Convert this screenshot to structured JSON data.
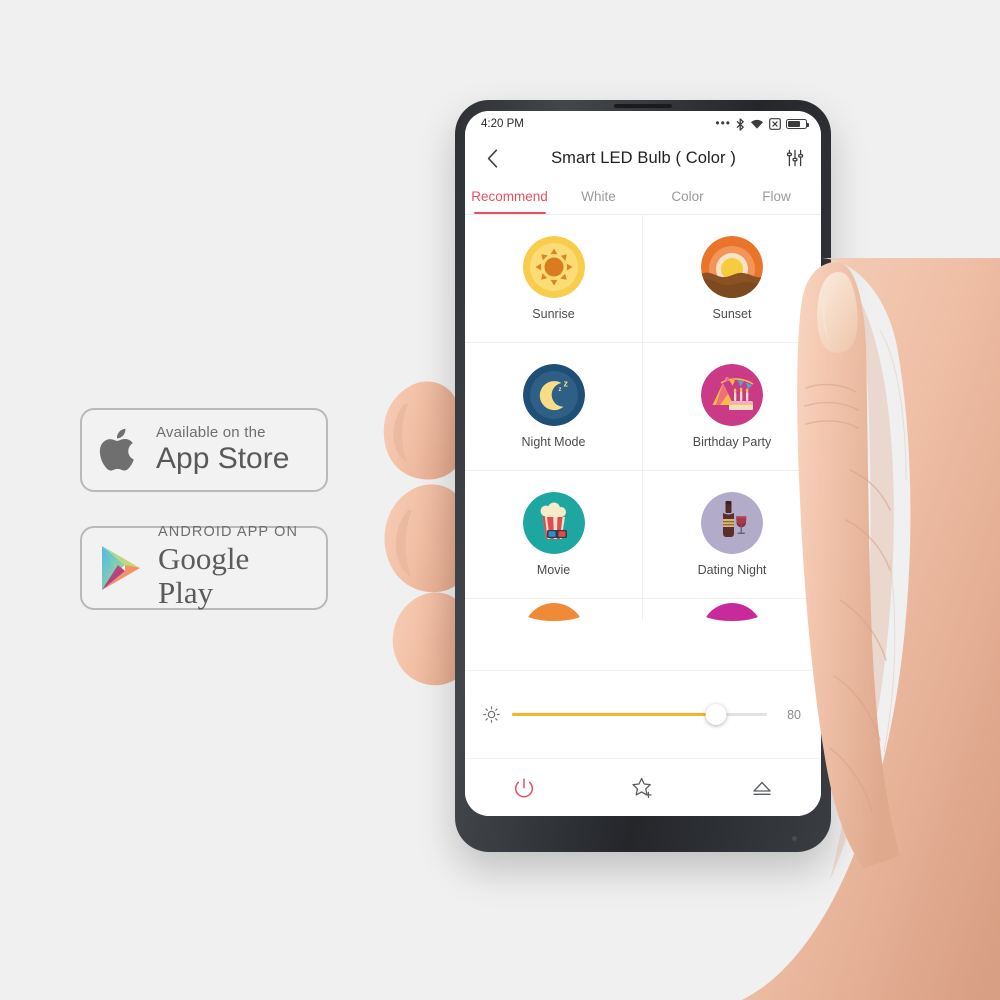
{
  "page": {
    "background_color": "#f0f0f0"
  },
  "badges": [
    {
      "name": "app-store",
      "logo": "apple-icon",
      "top_line": "Available on the",
      "main_line": "App Store"
    },
    {
      "name": "google-play",
      "logo": "google-play-icon",
      "top_line": "ANDROID APP ON",
      "main_line": "Google Play"
    }
  ],
  "phone": {
    "status_bar": {
      "time": "4:20 PM",
      "icons": [
        "more-dots-icon",
        "bluetooth-icon",
        "wifi-icon",
        "alarm-box-icon",
        "battery-icon"
      ],
      "battery_level": 74
    },
    "app_bar": {
      "back_icon": "chevron-left-icon",
      "title": "Smart LED Bulb ( Color )",
      "settings_icon": "sliders-icon"
    },
    "tabs": [
      {
        "label": "Recommend",
        "active": true
      },
      {
        "label": "White",
        "active": false
      },
      {
        "label": "Color",
        "active": false
      },
      {
        "label": "Flow",
        "active": false
      }
    ],
    "active_tab_color": "#e8505f",
    "scenes": [
      {
        "label": "Sunrise",
        "icon": "sunrise-icon",
        "color": "#f6c944"
      },
      {
        "label": "Sunset",
        "icon": "sunset-icon",
        "color": "#ec7a2e"
      },
      {
        "label": "Night Mode",
        "icon": "night-mode-icon",
        "color": "#22527c"
      },
      {
        "label": "Birthday Party",
        "icon": "birthday-party-icon",
        "color": "#cf3b87"
      },
      {
        "label": "Movie",
        "icon": "movie-icon",
        "color": "#1fa5a0"
      },
      {
        "label": "Dating Night",
        "icon": "dating-night-icon",
        "color": "#b3abcb"
      },
      {
        "label": "",
        "icon": "partial-orange-icon",
        "color": "#ef8a36"
      },
      {
        "label": "",
        "icon": "partial-magenta-icon",
        "color": "#c92a9b"
      }
    ],
    "brightness": {
      "icon": "brightness-sun-icon",
      "value": "80",
      "percent": 80,
      "fill_color": "#f5b721"
    },
    "bottom_bar": [
      {
        "icon": "power-icon",
        "color": "#e8505f"
      },
      {
        "icon": "star-add-icon",
        "color": "#5a5d60"
      },
      {
        "icon": "eject-icon",
        "color": "#5a5d60"
      }
    ]
  }
}
